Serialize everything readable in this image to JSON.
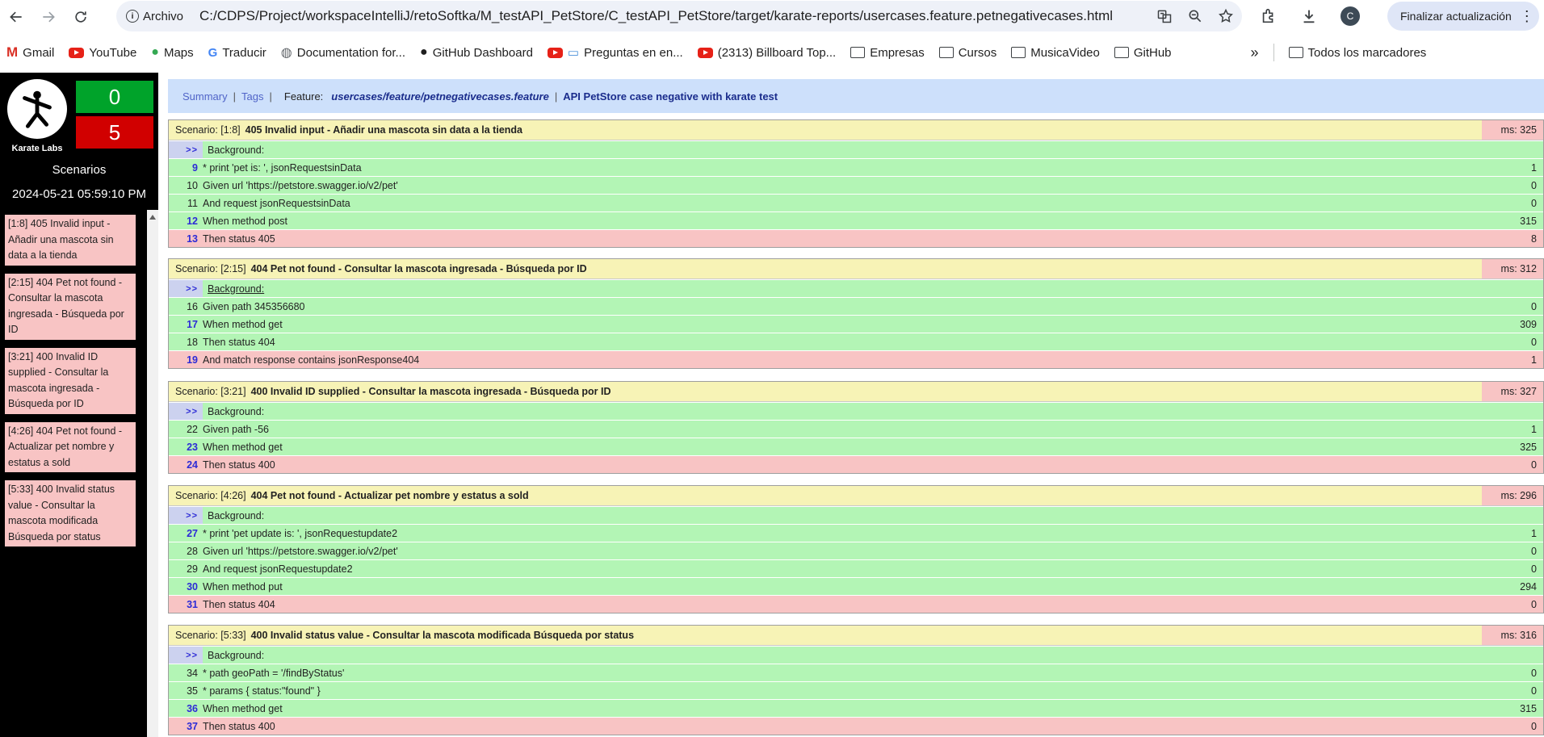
{
  "browser": {
    "site_label": "Archivo",
    "url": "C:/CDPS/Project/workspaceIntelliJ/retoSoftka/M_testAPI_PetStore/C_testAPI_PetStore/target/karate-reports/usercases.feature.petnegativecases.html",
    "avatar_letter": "C",
    "update_label": "Finalizar actualización",
    "bookmarks": [
      "Gmail",
      "YouTube",
      "Maps",
      "Traducir",
      "Documentation for...",
      "GitHub Dashboard",
      "Preguntas en en...",
      "(2313) Billboard Top...",
      "Empresas",
      "Cursos",
      "MusicaVideo",
      "GitHub"
    ],
    "more_label": "»",
    "all_bookmarks": "Todos los marcadores"
  },
  "sidebar": {
    "logo_label": "Karate Labs",
    "passed": "0",
    "failed": "5",
    "title": "Scenarios",
    "date": "2024-05-21 05:59:10 PM",
    "items": [
      "[1:8] 405 Invalid input - Añadir una mascota sin data a la tienda",
      "[2:15] 404 Pet not found - Consultar la mascota ingresada - Búsqueda por ID",
      "[3:21] 400 Invalid ID supplied - Consultar la mascota ingresada - Búsqueda por ID",
      "[4:26] 404 Pet not found - Actualizar pet nombre y estatus a sold",
      "[5:33] 400 Invalid status value - Consultar la mascota modificada Búsqueda por status"
    ]
  },
  "feature": {
    "summary": "Summary",
    "tags": "Tags",
    "label": "Feature:",
    "path": "usercases/feature/petnegativecases.feature",
    "separator": "|",
    "description": "API PetStore case negative with karate test"
  },
  "scenario_label": "Scenario:",
  "background_mark": ">>",
  "background_label": "Background:",
  "scenarios": [
    {
      "id": "[1:8]",
      "name": "405 Invalid input - Añadir una mascota sin data a la tienda",
      "ms": "ms: 325",
      "steps": [
        {
          "line": "9",
          "text": "* print 'pet is: ', jsonRequestsinData",
          "dur": "1",
          "status": "pass",
          "bold": true
        },
        {
          "line": "10",
          "text": "Given url 'https://petstore.swagger.io/v2/pet'",
          "dur": "0",
          "status": "pass",
          "bold": false
        },
        {
          "line": "11",
          "text": "And request jsonRequestsinData",
          "dur": "0",
          "status": "pass",
          "bold": false
        },
        {
          "line": "12",
          "text": "When method post",
          "dur": "315",
          "status": "pass",
          "bold": true
        },
        {
          "line": "13",
          "text": "Then status 405",
          "dur": "8",
          "status": "fail",
          "bold": true
        }
      ]
    },
    {
      "id": "[2:15]",
      "name": "404 Pet not found - Consultar la mascota ingresada - Búsqueda por ID",
      "ms": "ms: 312",
      "steps": [
        {
          "line": "16",
          "text": "Given path 345356680",
          "dur": "0",
          "status": "pass",
          "bold": false
        },
        {
          "line": "17",
          "text": "When method get",
          "dur": "309",
          "status": "pass",
          "bold": true
        },
        {
          "line": "18",
          "text": "Then status 404",
          "dur": "0",
          "status": "pass",
          "bold": false
        },
        {
          "line": "19",
          "text": "And match response contains jsonResponse404",
          "dur": "1",
          "status": "fail",
          "bold": true
        }
      ]
    },
    {
      "id": "[3:21]",
      "name": "400 Invalid ID supplied - Consultar la mascota ingresada - Búsqueda por ID",
      "ms": "ms: 327",
      "steps": [
        {
          "line": "22",
          "text": "Given path -56",
          "dur": "1",
          "status": "pass",
          "bold": false
        },
        {
          "line": "23",
          "text": "When method get",
          "dur": "325",
          "status": "pass",
          "bold": true
        },
        {
          "line": "24",
          "text": "Then status 400",
          "dur": "0",
          "status": "fail",
          "bold": true
        }
      ]
    },
    {
      "id": "[4:26]",
      "name": "404 Pet not found - Actualizar pet nombre y estatus a sold",
      "ms": "ms: 296",
      "steps": [
        {
          "line": "27",
          "text": "* print 'pet update is: ', jsonRequestupdate2",
          "dur": "1",
          "status": "pass",
          "bold": true
        },
        {
          "line": "28",
          "text": "Given url 'https://petstore.swagger.io/v2/pet'",
          "dur": "0",
          "status": "pass",
          "bold": false
        },
        {
          "line": "29",
          "text": "And request jsonRequestupdate2",
          "dur": "0",
          "status": "pass",
          "bold": false
        },
        {
          "line": "30",
          "text": "When method put",
          "dur": "294",
          "status": "pass",
          "bold": true
        },
        {
          "line": "31",
          "text": "Then status 404",
          "dur": "0",
          "status": "fail",
          "bold": true
        }
      ]
    },
    {
      "id": "[5:33]",
      "name": "400 Invalid status value - Consultar la mascota modificada Búsqueda por status",
      "ms": "ms: 316",
      "steps": [
        {
          "line": "34",
          "text": "* path geoPath = '/findByStatus'",
          "dur": "0",
          "status": "pass",
          "bold": false
        },
        {
          "line": "35",
          "text": "* params { status:\"found\" }",
          "dur": "0",
          "status": "pass",
          "bold": false
        },
        {
          "line": "36",
          "text": "When method get",
          "dur": "315",
          "status": "pass",
          "bold": true
        },
        {
          "line": "37",
          "text": "Then status 400",
          "dur": "0",
          "status": "fail",
          "bold": true
        }
      ]
    }
  ]
}
